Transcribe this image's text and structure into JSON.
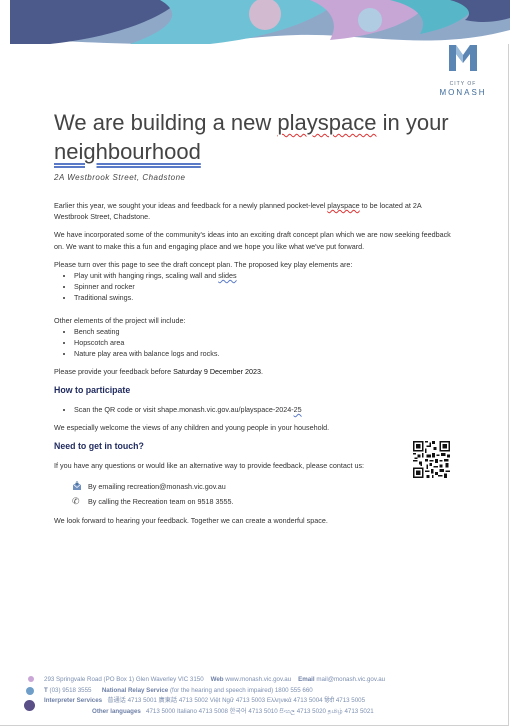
{
  "brand": {
    "city_of": "CITY OF",
    "name": "MONASH"
  },
  "title": {
    "part1": "We are building a new ",
    "squiggle_word": "playspace",
    "part2": " in your",
    "line2": "neighbourhood"
  },
  "address": "2A Westbrook Street, Chadstone",
  "intro": {
    "p1_before": "Earlier this year, we sought your ideas and feedback for a newly planned pocket-level ",
    "p1_squiggle": "playspace",
    "p1_after": " to be located at 2A Westbrook Street, Chadstone.",
    "p2": "We have incorporated some of the community's ideas into an exciting draft concept plan which we are now seeking feedback on. We want to make this a fun and engaging place and we hope you like what we've put forward.",
    "p3": "Please turn over this page to see the draft concept plan. The proposed key play elements are:"
  },
  "key_elements": [
    {
      "before": "Play unit with hanging rings, scaling wall and ",
      "squiggle": "slides"
    },
    {
      "before": "Spinner and rocker",
      "squiggle": ""
    },
    {
      "before": "Traditional swings.",
      "squiggle": ""
    }
  ],
  "other_intro": "Other elements of the project will include:",
  "other_elements": [
    "Bench seating",
    "Hopscotch area",
    "Nature play area with balance logs and rocks."
  ],
  "deadline": {
    "before": "Please provide your feedback before ",
    "date": "Saturday 9 December 2023",
    "after": "."
  },
  "participate": {
    "heading": "How to participate",
    "item_before": "Scan the QR code or visit shape.monash.vic.gov.au/playspace-2024-",
    "item_squiggle": "25",
    "welcome": "We especially welcome the views of any children and young people in your household."
  },
  "touch": {
    "heading": "Need to get in touch?",
    "intro": "If you have any questions or would like an alternative way to provide feedback, please contact us:",
    "email": "By emailing recreation@monash.vic.gov.au",
    "phone": "By calling the Recreation team on 9518 3555.",
    "closing": "We look forward to hearing your feedback. Together we can create a wonderful space."
  },
  "icons": {
    "email": "email-icon",
    "phone": "phone-icon",
    "qr": "qr-code-icon"
  },
  "footer": {
    "address": "293 Springvale Road (PO Box 1) Glen Waverley VIC 3150",
    "web_label": "Web",
    "web": "www.monash.vic.gov.au",
    "email_label": "Email",
    "email": "mail@monash.vic.gov.au",
    "phone_label": "T",
    "phone": "(03) 9518 3555",
    "relay_label": "National Relay Service",
    "relay": "(for the hearing and speech impaired) 1800 555 660",
    "interp_label": "Interpreter Services",
    "interp_line": "普通话 4713 5001   廣東話 4713 5002   Việt Ngữ 4713 5003   Ελληνικά 4713 5004   हिंदी 4713 5005",
    "other_label": "Other languages",
    "other_line": "4713 5000   Italiano 4713 5008   한국어 4713 5010   සිංහල 4713 5020   தமிழ் 4713 5021"
  },
  "colors": {
    "heading_navy": "#1f2a5e",
    "brand_blue": "#3d6a9a",
    "footer_text": "#7c8fb0"
  }
}
